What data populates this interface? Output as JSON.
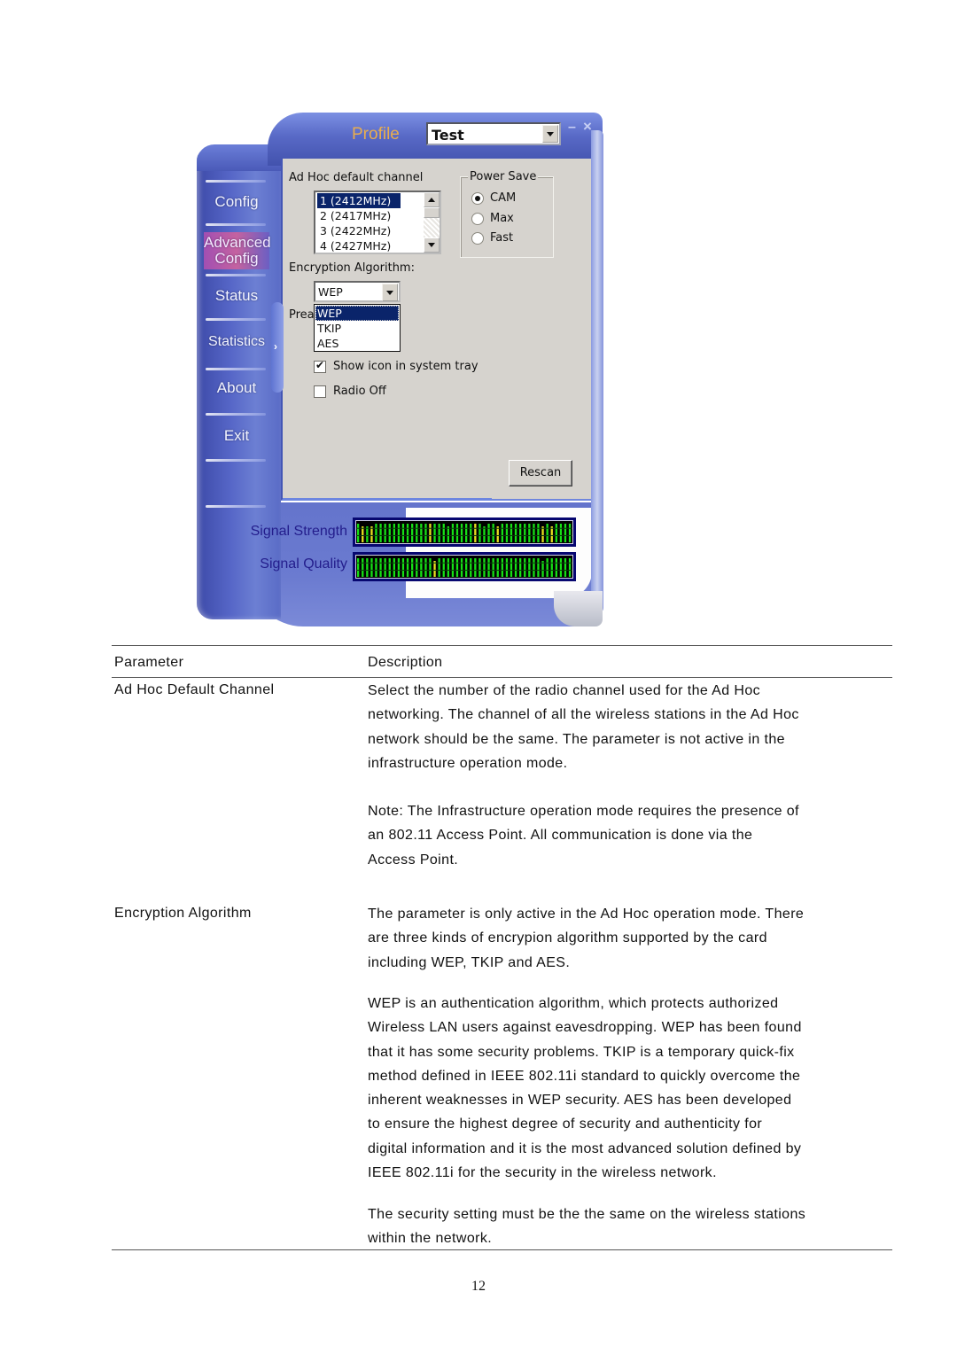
{
  "app": {
    "profile_label": "Profile",
    "profile_value": "Test",
    "window_controls": {
      "minimize": "–",
      "close": "×"
    },
    "nav": [
      {
        "label": "Config",
        "active": false
      },
      {
        "label": "Advanced\nConfig",
        "label_line1": "Advanced",
        "label_line2": "Config",
        "active": true
      },
      {
        "label": "Status",
        "active": false
      },
      {
        "label": "Statistics",
        "active": false
      },
      {
        "label": "About",
        "active": false
      },
      {
        "label": "Exit",
        "active": false
      }
    ],
    "adhoc": {
      "label": "Ad Hoc default channel",
      "channels": [
        "1  (2412MHz)",
        "2  (2417MHz)",
        "3  (2422MHz)",
        "4  (2427MHz)"
      ],
      "selected_index": 0
    },
    "power_save": {
      "label": "Power Save",
      "options": [
        "CAM",
        "Max",
        "Fast"
      ],
      "selected": "CAM"
    },
    "encryption": {
      "label": "Encryption Algorithm:",
      "value": "WEP",
      "options": [
        "WEP",
        "TKIP",
        "AES"
      ],
      "highlighted": "WEP"
    },
    "preamble_label_partial": "Prea",
    "checkboxes": [
      {
        "label": "Show icon in system tray",
        "checked": true
      },
      {
        "label": "Radio Off",
        "checked": false
      }
    ],
    "rescan_label": "Rescan",
    "signal": {
      "strength_label": "Signal Strength",
      "quality_label": "Signal Quality",
      "colors": {
        "good": "#16e016",
        "warn": "#e8e020",
        "frame": "#070770",
        "label": "#231d8c"
      }
    }
  },
  "doc": {
    "headers": {
      "parameter": "Parameter",
      "description": "Description"
    },
    "rows": [
      {
        "parameter": "Ad Hoc Default Channel",
        "description": [
          [
            "Select the number of the radio channel used for the Ad Hoc",
            "networking. The channel of all the wireless stations in the Ad Hoc",
            "network should be the same. The parameter is not active in the",
            "infrastructure operation mode."
          ],
          [
            "Note: The Infrastructure operation mode requires the presence of",
            "an 802.11 Access Point. All communication is done via the",
            "Access Point."
          ]
        ]
      },
      {
        "parameter": "Encryption Algorithm",
        "description": [
          [
            "The parameter is only active in the Ad Hoc operation mode. There",
            "are three kinds of encrypion algorithm supported by the card",
            "including WEP, TKIP and AES."
          ],
          [
            "WEP is an authentication algorithm, which protects authorized",
            "Wireless LAN users against eavesdropping. WEP has been found",
            "that it has some security problems. TKIP is a temporary quick-fix",
            "method defined in IEEE 802.11i standard to quickly overcome the",
            "inherent weaknesses in WEP security. AES has been developed",
            "to ensure the highest degree of security and authenticity for",
            "digital information and it is the most advanced solution defined by",
            "IEEE 802.11i for the security in the wireless network."
          ],
          [
            "The security setting must be the the same on the wireless stations",
            "within the network."
          ]
        ]
      }
    ],
    "page_number": "12"
  }
}
